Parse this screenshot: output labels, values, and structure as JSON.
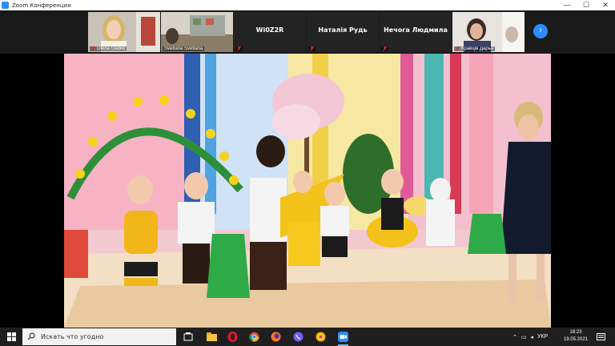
{
  "window": {
    "title": "Zoom Конференция",
    "controls": {
      "minimize": "—",
      "maximize": "☐",
      "close": "✕"
    }
  },
  "gallery": {
    "participants": [
      {
        "name": "Olena Gedko",
        "caption": "Olena Gedko",
        "type": "video",
        "muted": true
      },
      {
        "name": "Svetlana Svetlana",
        "caption": "Svetlana Svetlana",
        "type": "video",
        "muted": true
      },
      {
        "name": "Wi0Z2R",
        "caption": "",
        "type": "name",
        "muted": true
      },
      {
        "name": "Наталія Рудь",
        "caption": "",
        "type": "name",
        "muted": true
      },
      {
        "name": "Нечога Людмила",
        "caption": "",
        "type": "name",
        "muted": true
      },
      {
        "name": "Кравців Дарья",
        "caption": "Кравців Дарья",
        "type": "video",
        "muted": true
      }
    ],
    "next_page_icon": "chevron-right-icon"
  },
  "taskbar": {
    "search_placeholder": "Искать что угодно",
    "apps": [
      "task-view-icon",
      "explorer-icon",
      "opera-icon",
      "chrome-icon",
      "firefox-icon",
      "viber-icon",
      "chrome-alt-icon",
      "zoom-icon"
    ],
    "language": "УКР",
    "time": "18:23",
    "date": "19.05.2021"
  },
  "colors": {
    "zoom_blue": "#2d8cff",
    "taskbar": "#1f1f1f",
    "gallery_bg": "#1a1a1a"
  }
}
